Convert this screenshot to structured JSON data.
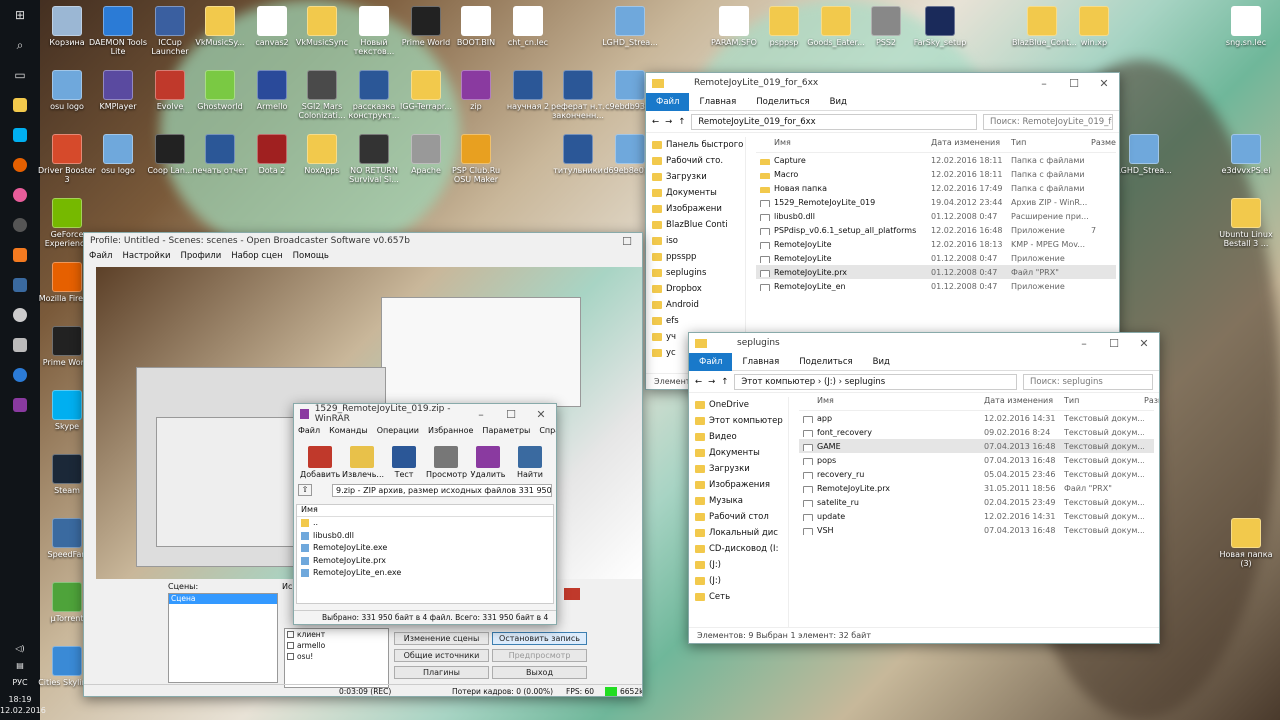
{
  "desktop_icons": [
    {
      "label": "Корзина",
      "color": "#9bb7d4"
    },
    {
      "label": "DAEMON Tools Lite",
      "color": "#2b7bd6"
    },
    {
      "label": "ICCup Launcher",
      "color": "#3a5fa0"
    },
    {
      "label": "VkMusicSy...",
      "color": "#f2c94c"
    },
    {
      "label": "canvas2",
      "color": "#ffffff"
    },
    {
      "label": "VkMusicSync",
      "color": "#f2c94c"
    },
    {
      "label": "Новый текстов...",
      "color": "#ffffff"
    },
    {
      "label": "Prime World",
      "color": "#222222"
    },
    {
      "label": "BOOT.BIN",
      "color": "#ffffff"
    },
    {
      "label": "cht_cn.lec",
      "color": "#ffffff"
    },
    {
      "label": "LGHD_Strea...",
      "color": "#6fa8dc"
    },
    {
      "label": "PARAM.SFO",
      "color": "#ffffff"
    },
    {
      "label": "psppsp",
      "color": "#f2c94c"
    },
    {
      "label": "Goods_Eater...",
      "color": "#f2c94c"
    },
    {
      "label": "PSS2",
      "color": "#888888"
    },
    {
      "label": "FarSky_setup",
      "color": "#1a2a5a"
    },
    {
      "label": "BlazBlue_Cont...",
      "color": "#f2c94c"
    },
    {
      "label": "win.xp",
      "color": "#f2c94c"
    },
    {
      "label": "sng.sn.lec",
      "color": "#ffffff"
    },
    {
      "label": "osu logo",
      "color": "#6fa8dc"
    },
    {
      "label": "KMPlayer",
      "color": "#5a4aa0"
    },
    {
      "label": "Evolve",
      "color": "#c0392b"
    },
    {
      "label": "Ghostworld",
      "color": "#7ac943"
    },
    {
      "label": "Armello",
      "color": "#2a4a9a"
    },
    {
      "label": "SGI2 Mars Colonizati...",
      "color": "#4a4a4a"
    },
    {
      "label": "рассказка конструкт...",
      "color": "#2b5797"
    },
    {
      "label": "IGG-Terrapr...",
      "color": "#f2c94c"
    },
    {
      "label": "zip",
      "color": "#8a3aa0"
    },
    {
      "label": "научная 2",
      "color": "#2b5797"
    },
    {
      "label": "реферат н.т. законченн...",
      "color": "#2b5797"
    },
    {
      "label": "c9ebdb93f...",
      "color": "#6fa8dc"
    },
    {
      "label": "Driver Booster 3",
      "color": "#d64a2b"
    },
    {
      "label": "osu logo",
      "color": "#6fa8dc"
    },
    {
      "label": "Coop Lan...",
      "color": "#222222"
    },
    {
      "label": "печать отчет",
      "color": "#2b5797"
    },
    {
      "label": "Dota 2",
      "color": "#a02020"
    },
    {
      "label": "NoxApps",
      "color": "#f2c94c"
    },
    {
      "label": "NO RETURN Survival Si...",
      "color": "#333333"
    },
    {
      "label": "Apache",
      "color": "#999999"
    },
    {
      "label": "PSP Club.Ru OSU Maker",
      "color": "#e8a020"
    },
    {
      "label": "титульники",
      "color": "#2b5797"
    },
    {
      "label": "d69eb8e01...",
      "color": "#6fa8dc"
    },
    {
      "label": "LGHD_Strea...",
      "color": "#6fa8dc"
    },
    {
      "label": "e3dvvxPS.el",
      "color": "#6fa8dc"
    },
    {
      "label": "GeForce Experience",
      "color": "#76b900"
    },
    {
      "label": "Mozilla Firefox",
      "color": "#e66000"
    },
    {
      "label": "Prime World",
      "color": "#222222"
    },
    {
      "label": "Skype",
      "color": "#00aff0"
    },
    {
      "label": "Steam",
      "color": "#1b2838"
    },
    {
      "label": "SpeedFan",
      "color": "#3a6aa0"
    },
    {
      "label": "µTorrent",
      "color": "#4ea33a"
    },
    {
      "label": "Cities Skylines",
      "color": "#3a8ad6"
    },
    {
      "label": "Google Chrome",
      "color": "#dddddd"
    },
    {
      "label": "FarSky",
      "color": "#1a2a5a"
    },
    {
      "label": "Uburi.mp4",
      "color": "#333333"
    },
    {
      "label": "ranbimpsd",
      "color": "#2b5797"
    },
    {
      "label": "splash_razz...",
      "color": "#6fa8dc"
    },
    {
      "label": "Apache logo",
      "color": "#999999"
    },
    {
      "label": "unsalv_iha...",
      "color": "#6fa8dc"
    },
    {
      "label": "Ubuntu Linux Bestall 3 ...",
      "color": "#f2c94c"
    },
    {
      "label": "Новая папка (3)",
      "color": "#f2c94c"
    }
  ],
  "taskbar": {
    "language": "РУС",
    "time": "18:19",
    "date": "12.02.2016"
  },
  "obs": {
    "title": "Profile: Untitled - Scenes: scenes - Open Broadcaster Software v0.657b",
    "menu": [
      "Файл",
      "Настройки",
      "Профили",
      "Набор сцен",
      "Помощь"
    ],
    "scenes_label": "Сцены:",
    "sources_label": "Ис",
    "scene_item": "Сцена",
    "sources": [
      "клиент",
      "armello",
      "osu!"
    ],
    "buttons": {
      "scene_settings": "Изменение сцены",
      "stop_recording": "Остановить запись",
      "global_sources": "Общие источники",
      "preview": "Предпросмотр",
      "plugins": "Плагины",
      "exit": "Выход"
    },
    "status": {
      "time": "0:03:09 (REC)",
      "dropped": "Потери кадров: 0 (0.00%)",
      "fps": "FPS: 60",
      "bitrate": "6652kb/s"
    }
  },
  "winrar": {
    "title": "1529_RemoteJoyLite_019.zip - WinRAR",
    "menu": [
      "Файл",
      "Команды",
      "Операции",
      "Избранное",
      "Параметры",
      "Справка"
    ],
    "tools": [
      "Добавить",
      "Извлечь...",
      "Тест",
      "Просмотр",
      "Удалить",
      "Найти"
    ],
    "path": "9.zip - ZIP архив, размер исходных файлов 331 950 байт",
    "col_name": "Имя",
    "files": [
      "..",
      "libusb0.dll",
      "RemoteJoyLite.exe",
      "RemoteJoyLite.prx",
      "RemoteJoyLite_en.exe"
    ],
    "status": "Выбрано: 331 950 байт в 4 файл. Всего: 331 950 байт в 4 файл"
  },
  "explorer1": {
    "title": "RemoteJoyLite_019_for_6xx",
    "ribbon": [
      "Файл",
      "Главная",
      "Поделиться",
      "Вид"
    ],
    "path": "RemoteJoyLite_019_for_6xx",
    "search": "Поиск: RemoteJoyLite_019_fo...",
    "nav": [
      "Панель быстрого",
      "Рабочий сто.",
      "Загрузки",
      "Документы",
      "Изображени",
      "BlazBlue Conti",
      "iso",
      "ppsspp",
      "seplugins",
      "Dropbox",
      "Android",
      "efs",
      "уч",
      "ус"
    ],
    "columns": [
      "Имя",
      "Дата изменения",
      "Тип",
      "Разме"
    ],
    "rows": [
      {
        "name": "Capture",
        "date": "12.02.2016 18:11",
        "type": "Папка с файлами",
        "size": "",
        "folder": true
      },
      {
        "name": "Macro",
        "date": "12.02.2016 18:11",
        "type": "Папка с файлами",
        "size": "",
        "folder": true
      },
      {
        "name": "Новая папка",
        "date": "12.02.2016 17:49",
        "type": "Папка с файлами",
        "size": "",
        "folder": true
      },
      {
        "name": "1529_RemoteJoyLite_019",
        "date": "19.04.2012 23:44",
        "type": "Архив ZIP - WinR...",
        "size": "",
        "folder": false
      },
      {
        "name": "libusb0.dll",
        "date": "01.12.2008 0:47",
        "type": "Расширение при...",
        "size": "",
        "folder": false
      },
      {
        "name": "PSPdisp_v0.6.1_setup_all_platforms",
        "date": "12.02.2016 16:48",
        "type": "Приложение",
        "size": "7",
        "folder": false
      },
      {
        "name": "RemoteJoyLite",
        "date": "12.02.2016 18:13",
        "type": "KMP - MPEG Mov...",
        "size": "",
        "folder": false
      },
      {
        "name": "RemoteJoyLite",
        "date": "01.12.2008 0:47",
        "type": "Приложение",
        "size": "",
        "folder": false
      },
      {
        "name": "RemoteJoyLite.prx",
        "date": "01.12.2008 0:47",
        "type": "Файл \"PRX\"",
        "size": "",
        "folder": false,
        "selected": true
      },
      {
        "name": "RemoteJoyLite_en",
        "date": "01.12.2008 0:47",
        "type": "Приложение",
        "size": "",
        "folder": false
      }
    ],
    "status": "Элемент"
  },
  "explorer2": {
    "title": "seplugins",
    "ribbon": [
      "Файл",
      "Главная",
      "Поделиться",
      "Вид"
    ],
    "path": "Этот компьютер  ›  (J:)  ›  seplugins",
    "search": "Поиск: seplugins",
    "nav": [
      "OneDrive",
      "Этот компьютер",
      "Видео",
      "Документы",
      "Загрузки",
      "Изображения",
      "Музыка",
      "Рабочий стол",
      "Локальный дис",
      "CD-дисковод (I:",
      "(J:)",
      "(J:)",
      "Сеть"
    ],
    "columns": [
      "Имя",
      "Дата изменения",
      "Тип",
      "Разме"
    ],
    "rows": [
      {
        "name": "app",
        "date": "12.02.2016 14:31",
        "type": "Текстовый докум..."
      },
      {
        "name": "font_recovery",
        "date": "09.02.2016 8:24",
        "type": "Текстовый докум..."
      },
      {
        "name": "GAME",
        "date": "07.04.2013 16:48",
        "type": "Текстовый докум...",
        "selected": true
      },
      {
        "name": "pops",
        "date": "07.04.2013 16:48",
        "type": "Текстовый докум..."
      },
      {
        "name": "recovery_ru",
        "date": "05.04.2015 23:46",
        "type": "Текстовый докум..."
      },
      {
        "name": "RemoteJoyLite.prx",
        "date": "31.05.2011 18:56",
        "type": "Файл \"PRX\""
      },
      {
        "name": "satelite_ru",
        "date": "02.04.2015 23:49",
        "type": "Текстовый докум..."
      },
      {
        "name": "update",
        "date": "12.02.2016 14:31",
        "type": "Текстовый докум..."
      },
      {
        "name": "VSH",
        "date": "07.04.2013 16:48",
        "type": "Текстовый докум..."
      }
    ],
    "status": "Элементов: 9     Выбран 1 элемент: 32 байт"
  }
}
